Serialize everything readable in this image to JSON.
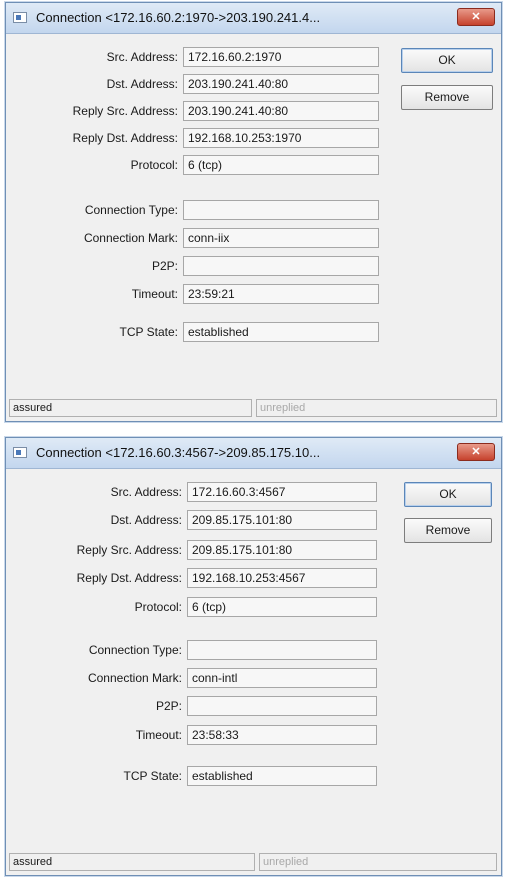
{
  "dialogs": [
    {
      "title": "Connection <172.16.60.2:1970->203.190.241.4...",
      "close_label": "✕",
      "buttons": {
        "ok": "OK",
        "remove": "Remove"
      },
      "fields": [
        {
          "label": "Src. Address:",
          "value": "172.16.60.2:1970"
        },
        {
          "label": "Dst. Address:",
          "value": "203.190.241.40:80"
        },
        {
          "label": "Reply Src. Address:",
          "value": "203.190.241.40:80"
        },
        {
          "label": "Reply Dst. Address:",
          "value": "192.168.10.253:1970"
        },
        {
          "label": "Protocol:",
          "value": "6 (tcp)"
        },
        {
          "label": "Connection Type:",
          "value": ""
        },
        {
          "label": "Connection Mark:",
          "value": "conn-iix"
        },
        {
          "label": "P2P:",
          "value": ""
        },
        {
          "label": "Timeout:",
          "value": "23:59:21"
        },
        {
          "label": "TCP State:",
          "value": "established"
        }
      ],
      "status": {
        "left": "assured",
        "right": "unreplied"
      }
    },
    {
      "title": "Connection <172.16.60.3:4567->209.85.175.10...",
      "close_label": "✕",
      "buttons": {
        "ok": "OK",
        "remove": "Remove"
      },
      "fields": [
        {
          "label": "Src. Address:",
          "value": "172.16.60.3:4567"
        },
        {
          "label": "Dst. Address:",
          "value": "209.85.175.101:80"
        },
        {
          "label": "Reply Src. Address:",
          "value": "209.85.175.101:80"
        },
        {
          "label": "Reply Dst. Address:",
          "value": "192.168.10.253:4567"
        },
        {
          "label": "Protocol:",
          "value": "6 (tcp)"
        },
        {
          "label": "Connection Type:",
          "value": ""
        },
        {
          "label": "Connection Mark:",
          "value": "conn-intl"
        },
        {
          "label": "P2P:",
          "value": ""
        },
        {
          "label": "Timeout:",
          "value": "23:58:33"
        },
        {
          "label": "TCP State:",
          "value": "established"
        }
      ],
      "status": {
        "left": "assured",
        "right": "unreplied"
      }
    }
  ]
}
